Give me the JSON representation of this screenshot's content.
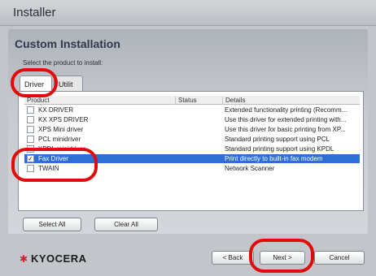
{
  "window": {
    "title": "Installer"
  },
  "page": {
    "title": "Custom Installation",
    "instruction": "Select the product to install:"
  },
  "tabs": [
    {
      "label": "Driver",
      "selected": true
    },
    {
      "label": "Utilit",
      "selected": false
    }
  ],
  "columns": [
    "Product",
    "Status",
    "Details"
  ],
  "rows": [
    {
      "product": "KX DRIVER",
      "status": "",
      "details": "Extended functionality printing (Recomm...",
      "checked": false,
      "selected": false
    },
    {
      "product": "KX XPS DRIVER",
      "status": "",
      "details": "Use this driver for extended printing with...",
      "checked": false,
      "selected": false
    },
    {
      "product": "XPS Mini driver",
      "status": "",
      "details": "Use this driver for basic printing from XP...",
      "checked": false,
      "selected": false
    },
    {
      "product": "PCL minidriver",
      "status": "",
      "details": "Standard printing support using PCL",
      "checked": false,
      "selected": false
    },
    {
      "product": "KPDL minidriver",
      "status": "",
      "details": "Standard printing support using KPDL",
      "checked": false,
      "selected": false
    },
    {
      "product": "Fax Driver",
      "status": "",
      "details": "Print directly to built-in fax modem",
      "checked": true,
      "selected": true
    },
    {
      "product": "TWAIN",
      "status": "",
      "details": "Network Scanner",
      "checked": false,
      "selected": false
    }
  ],
  "buttons": {
    "select_all": "Select All",
    "clear_all": "Clear All",
    "back": "< Back",
    "next": "Next >",
    "cancel": "Cancel"
  },
  "brand": {
    "name": "KYOCERA"
  },
  "colors": {
    "annotation": "#e10b0b",
    "selection": "#2e6fd6",
    "brand_red": "#d8202a"
  }
}
